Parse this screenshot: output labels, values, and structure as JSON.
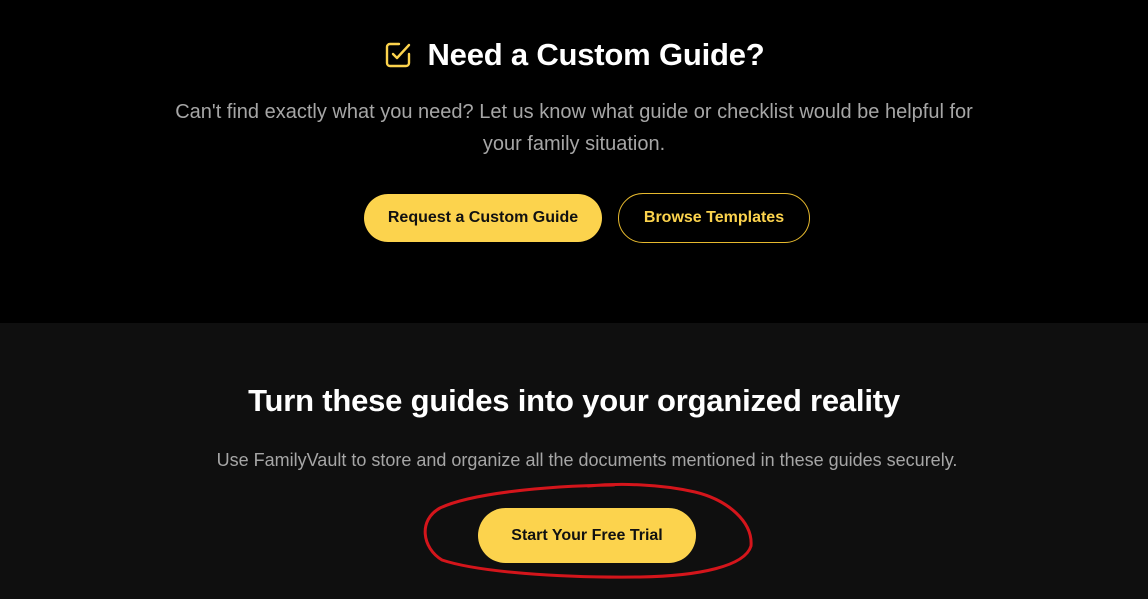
{
  "custom_guide": {
    "icon": "checkbox-pencil-icon",
    "title": "Need a Custom Guide?",
    "description": "Can't find exactly what you need? Let us know what guide or checklist would be helpful for your family situation.",
    "primary_button_label": "Request a Custom Guide",
    "secondary_button_label": "Browse Templates"
  },
  "cta": {
    "title": "Turn these guides into your organized reality",
    "description": "Use FamilyVault to store and organize all the documents mentioned in these guides securely.",
    "button_label": "Start Your Free Trial"
  },
  "colors": {
    "accent": "#fcd34d",
    "background_top": "#000000",
    "background_bottom": "#0f0f0f",
    "annotation": "#d4151b"
  }
}
